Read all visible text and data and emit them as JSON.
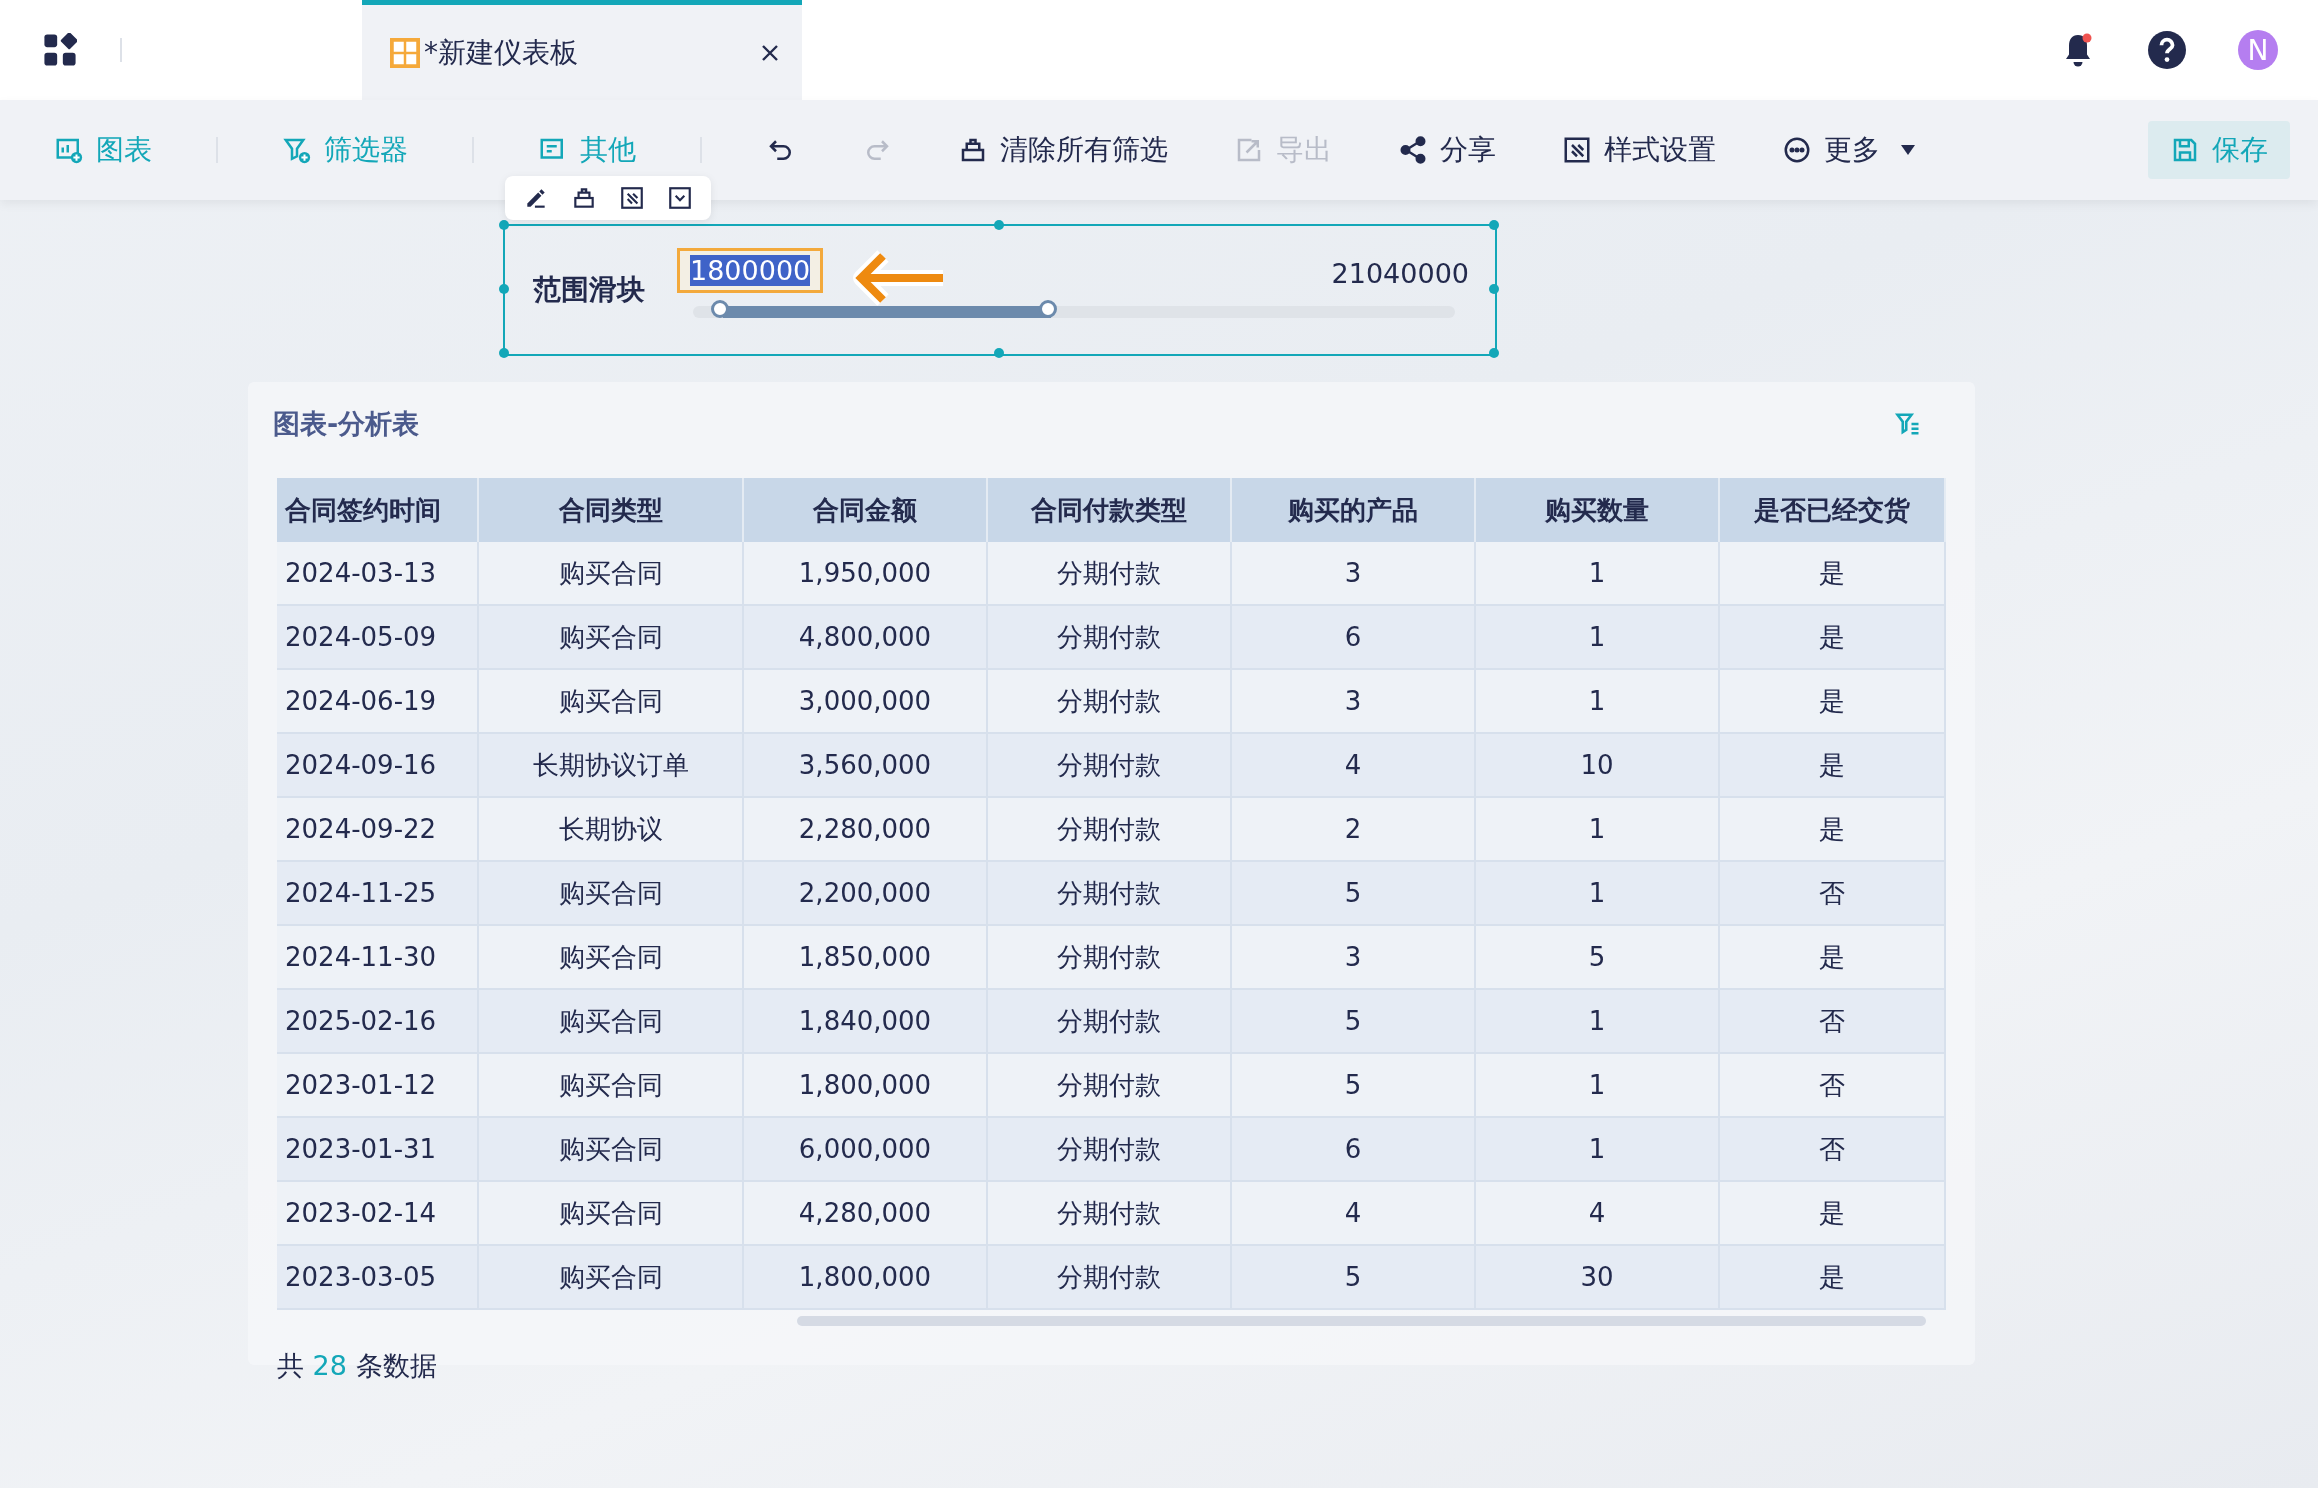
{
  "tab": {
    "title": "*新建仪表板"
  },
  "toolbar": [
    {
      "kind": "chart",
      "label": "图表",
      "disabled": false
    },
    {
      "kind": "filter",
      "label": "筛选器",
      "disabled": false
    },
    {
      "kind": "other",
      "label": "其他",
      "disabled": false
    },
    {
      "kind": "undo",
      "disabled": false
    },
    {
      "kind": "redo",
      "disabled": true
    },
    {
      "kind": "clear",
      "label": "清除所有筛选",
      "disabled": false
    },
    {
      "kind": "export",
      "label": "导出",
      "disabled": true
    },
    {
      "kind": "share",
      "label": "分享",
      "disabled": false
    },
    {
      "kind": "style",
      "label": "样式设置",
      "disabled": false
    },
    {
      "kind": "more",
      "label": "更多",
      "disabled": false
    },
    {
      "kind": "save",
      "label": "保存",
      "disabled": false
    }
  ],
  "header": {
    "has_notification": true,
    "avatar": "N"
  },
  "slider": {
    "label": "范围滑块",
    "min_value": "1800000",
    "max_value": "21040000",
    "thumbs": [
      {
        "level": 0.04
      },
      {
        "level": 0.47
      }
    ]
  },
  "table": {
    "title": "图表-分析表",
    "columns": [
      "合同签约时间",
      "合同类型",
      "合同金额",
      "合同付款类型",
      "购买的产品",
      "购买数量",
      "是否已经交货"
    ],
    "rows": [
      [
        "2024-03-13",
        "购买合同",
        "1,950,000",
        "分期付款",
        "3",
        "1",
        "是"
      ],
      [
        "2024-05-09",
        "购买合同",
        "4,800,000",
        "分期付款",
        "6",
        "1",
        "是"
      ],
      [
        "2024-06-19",
        "购买合同",
        "3,000,000",
        "分期付款",
        "3",
        "1",
        "是"
      ],
      [
        "2024-09-16",
        "长期协议订单",
        "3,560,000",
        "分期付款",
        "4",
        "10",
        "是"
      ],
      [
        "2024-09-22",
        "长期协议",
        "2,280,000",
        "分期付款",
        "2",
        "1",
        "是"
      ],
      [
        "2024-11-25",
        "购买合同",
        "2,200,000",
        "分期付款",
        "5",
        "1",
        "否"
      ],
      [
        "2024-11-30",
        "购买合同",
        "1,850,000",
        "分期付款",
        "3",
        "5",
        "是"
      ],
      [
        "2025-02-16",
        "购买合同",
        "1,840,000",
        "分期付款",
        "5",
        "1",
        "否"
      ],
      [
        "2023-01-12",
        "购买合同",
        "1,800,000",
        "分期付款",
        "5",
        "1",
        "否"
      ],
      [
        "2023-01-31",
        "购买合同",
        "6,000,000",
        "分期付款",
        "6",
        "1",
        "否"
      ],
      [
        "2023-02-14",
        "购买合同",
        "4,280,000",
        "分期付款",
        "4",
        "4",
        "是"
      ],
      [
        "2023-03-05",
        "购买合同",
        "1,800,000",
        "分期付款",
        "5",
        "30",
        "是"
      ]
    ],
    "footer": {
      "prefix": "共",
      "count": "28",
      "suffix": "条数据"
    }
  }
}
